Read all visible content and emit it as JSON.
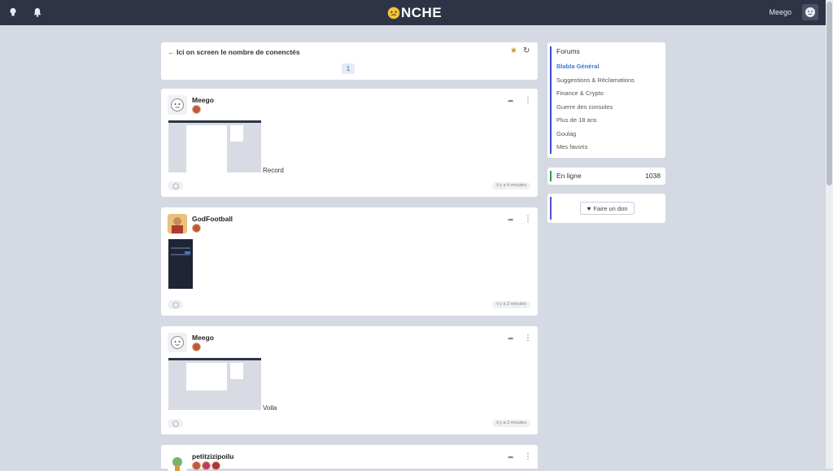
{
  "header": {
    "brand_prefix": "☺",
    "brand_name": "NCHE",
    "username": "Meego",
    "left_icons": [
      "lightbulb-icon",
      "bell-icon"
    ]
  },
  "topic": {
    "title": "Ici on screen le nombre de conenctés",
    "page": "1",
    "star_color": "#e8871e"
  },
  "posts": [
    {
      "author": "Meego",
      "caption": "Record",
      "time": "il y a 4 minutes"
    },
    {
      "author": "GodFootball",
      "caption": "",
      "time": "il y a 3 minutes"
    },
    {
      "author": "Meego",
      "caption": "Voila",
      "time": "il y a 3 minutes"
    },
    {
      "author": "petitzizipoilu",
      "caption": "",
      "time": ""
    }
  ],
  "sidebar": {
    "forums_title": "Forums",
    "items": [
      "Blabla Général",
      "Suggestions & Réclamations",
      "Finance & Crypto",
      "Guerre des consoles",
      "Plus de 18 ans",
      "Goulag",
      "Mes favoris"
    ],
    "active_item_color": "#3b79d8",
    "online_label": "En ligne",
    "online_count": "1038",
    "donate_label": "Faire un don"
  },
  "colors": {
    "topbar": "#2e3445",
    "background": "#d5d9e3"
  }
}
